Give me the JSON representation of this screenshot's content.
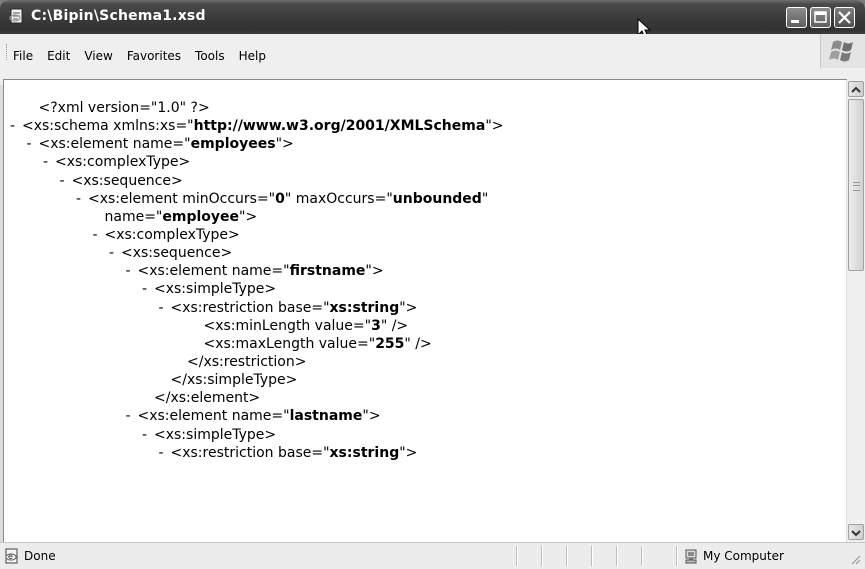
{
  "window": {
    "title": "C:\\Bipin\\Schema1.xsd"
  },
  "menu": {
    "items": [
      "File",
      "Edit",
      "View",
      "Favorites",
      "Tools",
      "Help"
    ]
  },
  "xml_lines": [
    {
      "indent": 1,
      "mark": "",
      "segs": [
        [
          "<?xml version=\"1.0\" ?>",
          0
        ]
      ]
    },
    {
      "indent": 0,
      "mark": "-",
      "segs": [
        [
          "<xs:schema xmlns:xs=\"",
          0
        ],
        [
          "http://www.w3.org/2001/XMLSchema",
          1
        ],
        [
          "\">",
          0
        ]
      ]
    },
    {
      "indent": 1,
      "mark": "-",
      "segs": [
        [
          "<xs:element name=\"",
          0
        ],
        [
          "employees",
          1
        ],
        [
          "\">",
          0
        ]
      ]
    },
    {
      "indent": 2,
      "mark": "-",
      "segs": [
        [
          "<xs:complexType>",
          0
        ]
      ]
    },
    {
      "indent": 3,
      "mark": "-",
      "segs": [
        [
          "<xs:sequence>",
          0
        ]
      ]
    },
    {
      "indent": 4,
      "mark": "-",
      "segs": [
        [
          "<xs:element minOccurs=\"",
          0
        ],
        [
          "0",
          1
        ],
        [
          "\" maxOccurs=\"",
          0
        ],
        [
          "unbounded",
          1
        ],
        [
          "\"",
          0
        ]
      ]
    },
    {
      "indent": 5,
      "mark": "",
      "segs": [
        [
          "name=\"",
          0
        ],
        [
          "employee",
          1
        ],
        [
          "\">",
          0
        ]
      ]
    },
    {
      "indent": 5,
      "mark": "-",
      "segs": [
        [
          "<xs:complexType>",
          0
        ]
      ]
    },
    {
      "indent": 6,
      "mark": "-",
      "segs": [
        [
          "<xs:sequence>",
          0
        ]
      ]
    },
    {
      "indent": 7,
      "mark": "-",
      "segs": [
        [
          "<xs:element name=\"",
          0
        ],
        [
          "firstname",
          1
        ],
        [
          "\">",
          0
        ]
      ]
    },
    {
      "indent": 8,
      "mark": "-",
      "segs": [
        [
          "<xs:simpleType>",
          0
        ]
      ]
    },
    {
      "indent": 9,
      "mark": "-",
      "segs": [
        [
          "<xs:restriction base=\"",
          0
        ],
        [
          "xs:string",
          1
        ],
        [
          "\">",
          0
        ]
      ]
    },
    {
      "indent": 11,
      "mark": "",
      "segs": [
        [
          "<xs:minLength value=\"",
          0
        ],
        [
          "3",
          1
        ],
        [
          "\" />",
          0
        ]
      ]
    },
    {
      "indent": 11,
      "mark": "",
      "segs": [
        [
          "<xs:maxLength value=\"",
          0
        ],
        [
          "255",
          1
        ],
        [
          "\" />",
          0
        ]
      ]
    },
    {
      "indent": 10,
      "mark": "",
      "segs": [
        [
          "</xs:restriction>",
          0
        ]
      ]
    },
    {
      "indent": 9,
      "mark": "",
      "segs": [
        [
          "</xs:simpleType>",
          0
        ]
      ]
    },
    {
      "indent": 8,
      "mark": "",
      "segs": [
        [
          "</xs:element>",
          0
        ]
      ]
    },
    {
      "indent": 7,
      "mark": "-",
      "segs": [
        [
          "<xs:element name=\"",
          0
        ],
        [
          "lastname",
          1
        ],
        [
          "\">",
          0
        ]
      ]
    },
    {
      "indent": 8,
      "mark": "-",
      "segs": [
        [
          "<xs:simpleType>",
          0
        ]
      ]
    },
    {
      "indent": 9,
      "mark": "-",
      "segs": [
        [
          "<xs:restriction base=\"",
          0
        ],
        [
          "xs:string",
          1
        ],
        [
          "\">",
          0
        ]
      ]
    }
  ],
  "statusbar": {
    "text": "Done",
    "zone": "My Computer"
  },
  "icons": {
    "app": "ie-document-icon",
    "minimize": "minimize-icon",
    "maximize": "maximize-icon",
    "close": "close-icon",
    "status": "page-done-icon",
    "zone": "my-computer-icon"
  }
}
